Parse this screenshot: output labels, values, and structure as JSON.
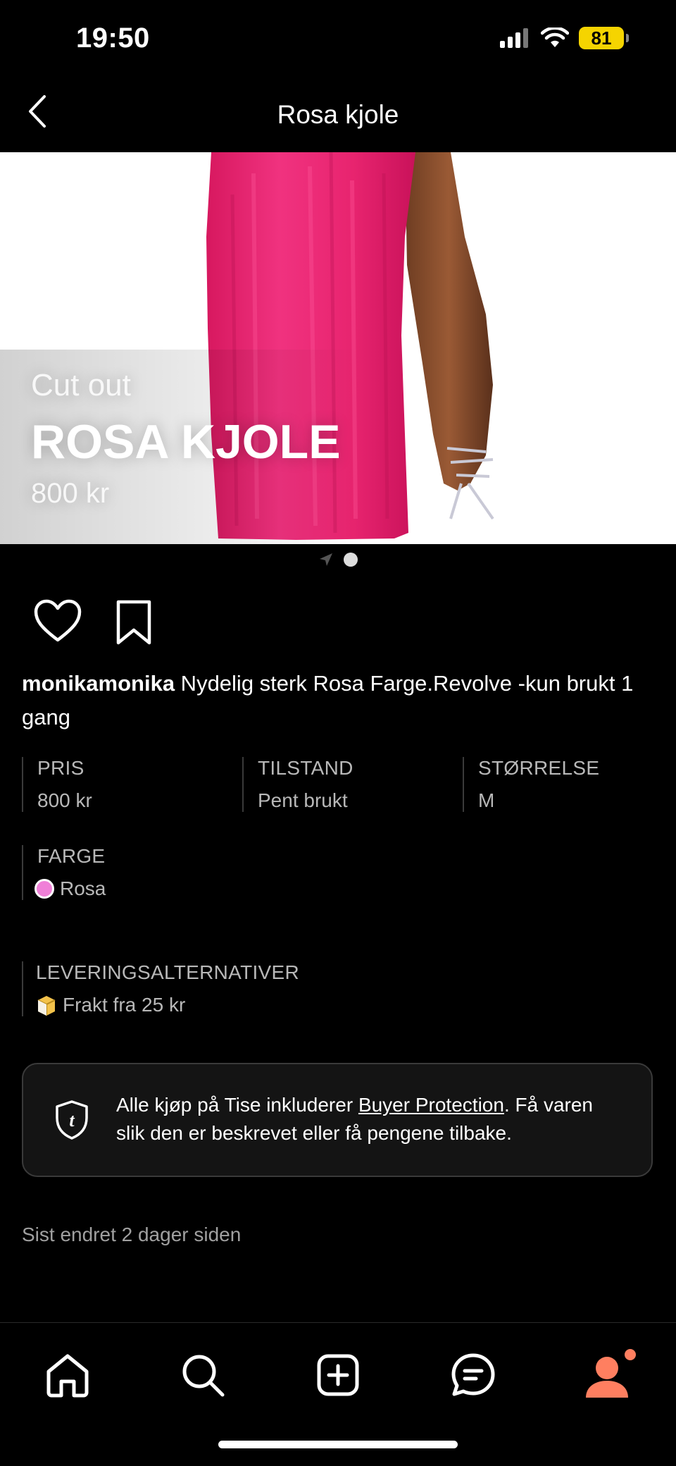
{
  "status_bar": {
    "time": "19:50",
    "battery": "81"
  },
  "nav": {
    "title": "Rosa kjole"
  },
  "hero": {
    "subtitle": "Cut out",
    "title": "ROSA KJOLE",
    "price": "800 kr",
    "dress_color": "#ee1f74"
  },
  "listing": {
    "username": "monikamonika",
    "description": " Nydelig sterk Rosa Farge.Revolve -kun brukt 1 gang"
  },
  "attributes": {
    "price": {
      "label": "PRIS",
      "value": "800 kr"
    },
    "condition": {
      "label": "TILSTAND",
      "value": "Pent brukt"
    },
    "size": {
      "label": "STØRRELSE",
      "value": "M"
    },
    "color": {
      "label": "FARGE",
      "value": "Rosa",
      "swatch": "#f080d8"
    },
    "delivery": {
      "label": "LEVERINGSALTERNATIVER",
      "value": "Frakt fra 25 kr"
    }
  },
  "protection": {
    "text_before": "Alle kjøp på Tise inkluderer ",
    "link": "Buyer Protection",
    "text_after": ". Få varen slik den er beskrevet eller få pengene tilbake."
  },
  "last_edited": "Sist endret 2 dager siden",
  "tabs": {
    "icons": [
      "home-icon",
      "search-icon",
      "add-icon",
      "chat-icon",
      "profile-icon"
    ],
    "profile_color": "#ff7f60"
  }
}
